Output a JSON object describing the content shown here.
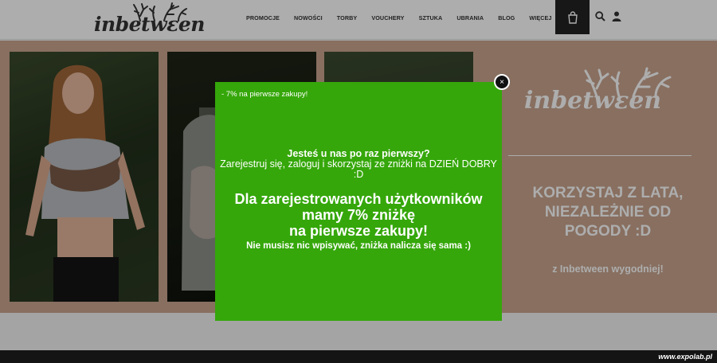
{
  "header": {
    "logo_text": "inbetwεen",
    "nav": [
      "PROMOCJE",
      "NOWOŚCI",
      "TORBY",
      "VOUCHERY",
      "SZTUKA",
      "UBRANIA",
      "BLOG",
      "WIĘCEJ"
    ],
    "icons": [
      "cart-icon",
      "search-icon",
      "user-icon"
    ]
  },
  "hero": {
    "brand_logo": "inbetwεen",
    "headline": [
      "KORZYSTAJ Z LATA,",
      "NIEZALEŻNIE OD",
      "POGODY :D"
    ],
    "subline": "z Inbetween wygodniej!"
  },
  "popup": {
    "title": "- 7% na pierwsze zakupy!",
    "line1": "Jesteś u nas po raz pierwszy?",
    "line2": "Zarejestruj się, zaloguj i skorzystaj ze zniżki na DZIEŃ DOBRY :D",
    "line3": "Dla zarejestrowanych użytkowników",
    "line4": "mamy 7% zniżkę",
    "line5": "na pierwsze zakupy!",
    "line6": "Nie musisz nic wpisywać, zniżka nalicza się sama :)",
    "close_label": "×"
  },
  "watermark": "www.expolab.pl",
  "colors": {
    "popup_bg": "#35a70a",
    "hero_bg": "#c9a48e",
    "cart_bg": "#222222"
  }
}
